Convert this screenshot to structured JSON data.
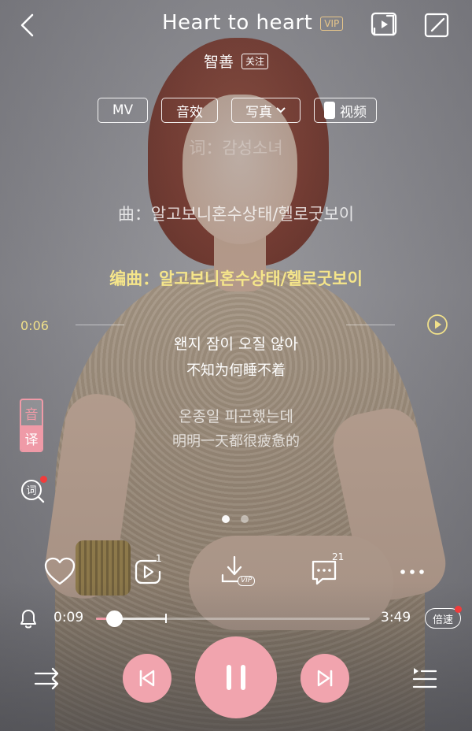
{
  "header": {
    "title": "Heart to heart",
    "vip_badge": "VIP",
    "artist": "智善",
    "follow_label": "关注"
  },
  "chips": {
    "mv": "MV",
    "sound_effect": "音效",
    "photo": "写真",
    "video": "视频"
  },
  "lyrics": {
    "faded_line": "词：감성소녀",
    "composer_line": "曲：알고보니혼수상태/헬로굿보이",
    "arranger_line": "编曲：알고보니혼수상태/헬로굿보이",
    "line1": "왠지 잠이 오질 않아",
    "line1_translation": "不知为何睡不着",
    "line2": "온종일 피곤했는데",
    "line2_translation": "明明一天都很疲惫的"
  },
  "lyric_seek": {
    "time": "0:06"
  },
  "toggle": {
    "top": "音",
    "bottom": "译"
  },
  "actions": {
    "share_count": "1",
    "comment_count": "21",
    "download_badge": "VIP"
  },
  "progress": {
    "current": "0:09",
    "total": "3:49",
    "fraction": 0.065,
    "buffered": 0.26,
    "speed_label": "倍速"
  },
  "pager": {
    "pages": 2,
    "active": 0
  },
  "colors": {
    "accent": "#f1a4ae",
    "lyric_highlight": "#f5e58a",
    "vip_gold": "#e7c68b",
    "notify_red": "#f03c3c"
  },
  "icons": {
    "back": "chevron-left-icon",
    "cast": "cast-icon",
    "edit": "edit-icon",
    "seek_play": "play-circle-icon",
    "lyric_mode": "lyric-search-icon",
    "like": "heart-icon",
    "share": "share-icon",
    "download": "download-icon",
    "comment": "comment-icon",
    "more": "more-icon",
    "alarm": "bell-icon",
    "shuffle": "shuffle-icon",
    "prev": "prev-icon",
    "pause": "pause-icon",
    "next": "next-icon",
    "playlist": "playlist-icon"
  }
}
